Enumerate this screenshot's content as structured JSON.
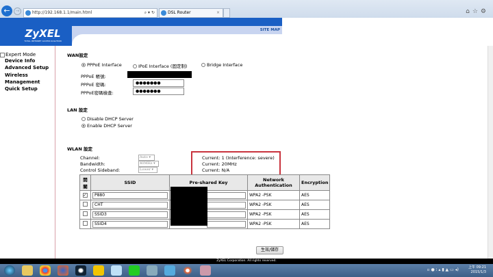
{
  "browser": {
    "url": "http://192.168.1.1/main.html",
    "tab_title": "DSL Router",
    "addr_tools": "⌕ ▾ ↻",
    "right_icons": "⌂☆⚙"
  },
  "header": {
    "logo": "ZyXEL",
    "logo_tagline": "TOTAL INTERNET ACCESS SOLUTION",
    "site_map": "SITE MAP"
  },
  "sidebar": {
    "expert_mode": "Expert Mode",
    "items": [
      "Device Info",
      "Advanced Setup",
      "Wireless",
      "Management",
      "Quick Setup"
    ]
  },
  "wan": {
    "title": "WAN設定",
    "options": [
      "PPPoE Interface",
      "IPoE Interface (固定制)",
      "Bridge Interface"
    ],
    "selected": 0,
    "fields": [
      {
        "label": "PPPoE 帳號:",
        "value": ""
      },
      {
        "label": "PPPoE 密碼:",
        "value": "●●●●●●●"
      },
      {
        "label": "PPPoE密碼檢查:",
        "value": "●●●●●●●"
      }
    ]
  },
  "lan": {
    "title": "LAN 設定",
    "options": [
      "Disable DHCP Server",
      "Enable DHCP Server"
    ],
    "selected": 1
  },
  "wlan": {
    "title": "WLAN 設定",
    "settings": [
      {
        "label": "Channel:",
        "value": "Auto",
        "current": "Current: 1 (Interference: severe)"
      },
      {
        "label": "Bandwidth:",
        "value": "40MHz",
        "current": "Current: 20MHz"
      },
      {
        "label": "Control Sideband:",
        "value": "Lower",
        "current": "Current: N/A"
      }
    ],
    "columns": [
      "開關",
      "SSID",
      "Pre-shared Key",
      "Network Authentication",
      "Encryption"
    ],
    "rows": [
      {
        "enabled": true,
        "ssid": "P880",
        "auth": "WPA2 -PSK",
        "enc": "AES"
      },
      {
        "enabled": false,
        "ssid": "CHT",
        "auth": "WPA2 -PSK",
        "enc": "AES"
      },
      {
        "enabled": false,
        "ssid": "SSID3",
        "auth": "WPA2 -PSK",
        "enc": "AES"
      },
      {
        "enabled": false,
        "ssid": "SSID4",
        "auth": "WPA2 -PSK",
        "enc": "AES"
      }
    ]
  },
  "apply_button": "生效/儲存",
  "footer": "ZyXEL Corporation. All rights reserved.",
  "taskbar": {
    "time": "上午 09:21",
    "date": "2015/1/3"
  }
}
